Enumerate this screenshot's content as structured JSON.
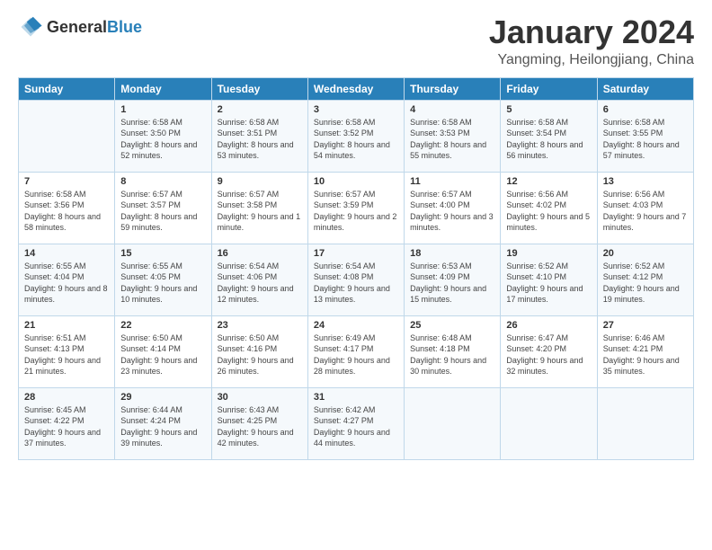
{
  "header": {
    "logo_general": "General",
    "logo_blue": "Blue",
    "month": "January 2024",
    "location": "Yangming, Heilongjiang, China"
  },
  "columns": [
    "Sunday",
    "Monday",
    "Tuesday",
    "Wednesday",
    "Thursday",
    "Friday",
    "Saturday"
  ],
  "weeks": [
    [
      {
        "day": "",
        "sunrise": "",
        "sunset": "",
        "daylight": ""
      },
      {
        "day": "1",
        "sunrise": "Sunrise: 6:58 AM",
        "sunset": "Sunset: 3:50 PM",
        "daylight": "Daylight: 8 hours and 52 minutes."
      },
      {
        "day": "2",
        "sunrise": "Sunrise: 6:58 AM",
        "sunset": "Sunset: 3:51 PM",
        "daylight": "Daylight: 8 hours and 53 minutes."
      },
      {
        "day": "3",
        "sunrise": "Sunrise: 6:58 AM",
        "sunset": "Sunset: 3:52 PM",
        "daylight": "Daylight: 8 hours and 54 minutes."
      },
      {
        "day": "4",
        "sunrise": "Sunrise: 6:58 AM",
        "sunset": "Sunset: 3:53 PM",
        "daylight": "Daylight: 8 hours and 55 minutes."
      },
      {
        "day": "5",
        "sunrise": "Sunrise: 6:58 AM",
        "sunset": "Sunset: 3:54 PM",
        "daylight": "Daylight: 8 hours and 56 minutes."
      },
      {
        "day": "6",
        "sunrise": "Sunrise: 6:58 AM",
        "sunset": "Sunset: 3:55 PM",
        "daylight": "Daylight: 8 hours and 57 minutes."
      }
    ],
    [
      {
        "day": "7",
        "sunrise": "Sunrise: 6:58 AM",
        "sunset": "Sunset: 3:56 PM",
        "daylight": "Daylight: 8 hours and 58 minutes."
      },
      {
        "day": "8",
        "sunrise": "Sunrise: 6:57 AM",
        "sunset": "Sunset: 3:57 PM",
        "daylight": "Daylight: 8 hours and 59 minutes."
      },
      {
        "day": "9",
        "sunrise": "Sunrise: 6:57 AM",
        "sunset": "Sunset: 3:58 PM",
        "daylight": "Daylight: 9 hours and 1 minute."
      },
      {
        "day": "10",
        "sunrise": "Sunrise: 6:57 AM",
        "sunset": "Sunset: 3:59 PM",
        "daylight": "Daylight: 9 hours and 2 minutes."
      },
      {
        "day": "11",
        "sunrise": "Sunrise: 6:57 AM",
        "sunset": "Sunset: 4:00 PM",
        "daylight": "Daylight: 9 hours and 3 minutes."
      },
      {
        "day": "12",
        "sunrise": "Sunrise: 6:56 AM",
        "sunset": "Sunset: 4:02 PM",
        "daylight": "Daylight: 9 hours and 5 minutes."
      },
      {
        "day": "13",
        "sunrise": "Sunrise: 6:56 AM",
        "sunset": "Sunset: 4:03 PM",
        "daylight": "Daylight: 9 hours and 7 minutes."
      }
    ],
    [
      {
        "day": "14",
        "sunrise": "Sunrise: 6:55 AM",
        "sunset": "Sunset: 4:04 PM",
        "daylight": "Daylight: 9 hours and 8 minutes."
      },
      {
        "day": "15",
        "sunrise": "Sunrise: 6:55 AM",
        "sunset": "Sunset: 4:05 PM",
        "daylight": "Daylight: 9 hours and 10 minutes."
      },
      {
        "day": "16",
        "sunrise": "Sunrise: 6:54 AM",
        "sunset": "Sunset: 4:06 PM",
        "daylight": "Daylight: 9 hours and 12 minutes."
      },
      {
        "day": "17",
        "sunrise": "Sunrise: 6:54 AM",
        "sunset": "Sunset: 4:08 PM",
        "daylight": "Daylight: 9 hours and 13 minutes."
      },
      {
        "day": "18",
        "sunrise": "Sunrise: 6:53 AM",
        "sunset": "Sunset: 4:09 PM",
        "daylight": "Daylight: 9 hours and 15 minutes."
      },
      {
        "day": "19",
        "sunrise": "Sunrise: 6:52 AM",
        "sunset": "Sunset: 4:10 PM",
        "daylight": "Daylight: 9 hours and 17 minutes."
      },
      {
        "day": "20",
        "sunrise": "Sunrise: 6:52 AM",
        "sunset": "Sunset: 4:12 PM",
        "daylight": "Daylight: 9 hours and 19 minutes."
      }
    ],
    [
      {
        "day": "21",
        "sunrise": "Sunrise: 6:51 AM",
        "sunset": "Sunset: 4:13 PM",
        "daylight": "Daylight: 9 hours and 21 minutes."
      },
      {
        "day": "22",
        "sunrise": "Sunrise: 6:50 AM",
        "sunset": "Sunset: 4:14 PM",
        "daylight": "Daylight: 9 hours and 23 minutes."
      },
      {
        "day": "23",
        "sunrise": "Sunrise: 6:50 AM",
        "sunset": "Sunset: 4:16 PM",
        "daylight": "Daylight: 9 hours and 26 minutes."
      },
      {
        "day": "24",
        "sunrise": "Sunrise: 6:49 AM",
        "sunset": "Sunset: 4:17 PM",
        "daylight": "Daylight: 9 hours and 28 minutes."
      },
      {
        "day": "25",
        "sunrise": "Sunrise: 6:48 AM",
        "sunset": "Sunset: 4:18 PM",
        "daylight": "Daylight: 9 hours and 30 minutes."
      },
      {
        "day": "26",
        "sunrise": "Sunrise: 6:47 AM",
        "sunset": "Sunset: 4:20 PM",
        "daylight": "Daylight: 9 hours and 32 minutes."
      },
      {
        "day": "27",
        "sunrise": "Sunrise: 6:46 AM",
        "sunset": "Sunset: 4:21 PM",
        "daylight": "Daylight: 9 hours and 35 minutes."
      }
    ],
    [
      {
        "day": "28",
        "sunrise": "Sunrise: 6:45 AM",
        "sunset": "Sunset: 4:22 PM",
        "daylight": "Daylight: 9 hours and 37 minutes."
      },
      {
        "day": "29",
        "sunrise": "Sunrise: 6:44 AM",
        "sunset": "Sunset: 4:24 PM",
        "daylight": "Daylight: 9 hours and 39 minutes."
      },
      {
        "day": "30",
        "sunrise": "Sunrise: 6:43 AM",
        "sunset": "Sunset: 4:25 PM",
        "daylight": "Daylight: 9 hours and 42 minutes."
      },
      {
        "day": "31",
        "sunrise": "Sunrise: 6:42 AM",
        "sunset": "Sunset: 4:27 PM",
        "daylight": "Daylight: 9 hours and 44 minutes."
      },
      {
        "day": "",
        "sunrise": "",
        "sunset": "",
        "daylight": ""
      },
      {
        "day": "",
        "sunrise": "",
        "sunset": "",
        "daylight": ""
      },
      {
        "day": "",
        "sunrise": "",
        "sunset": "",
        "daylight": ""
      }
    ]
  ]
}
